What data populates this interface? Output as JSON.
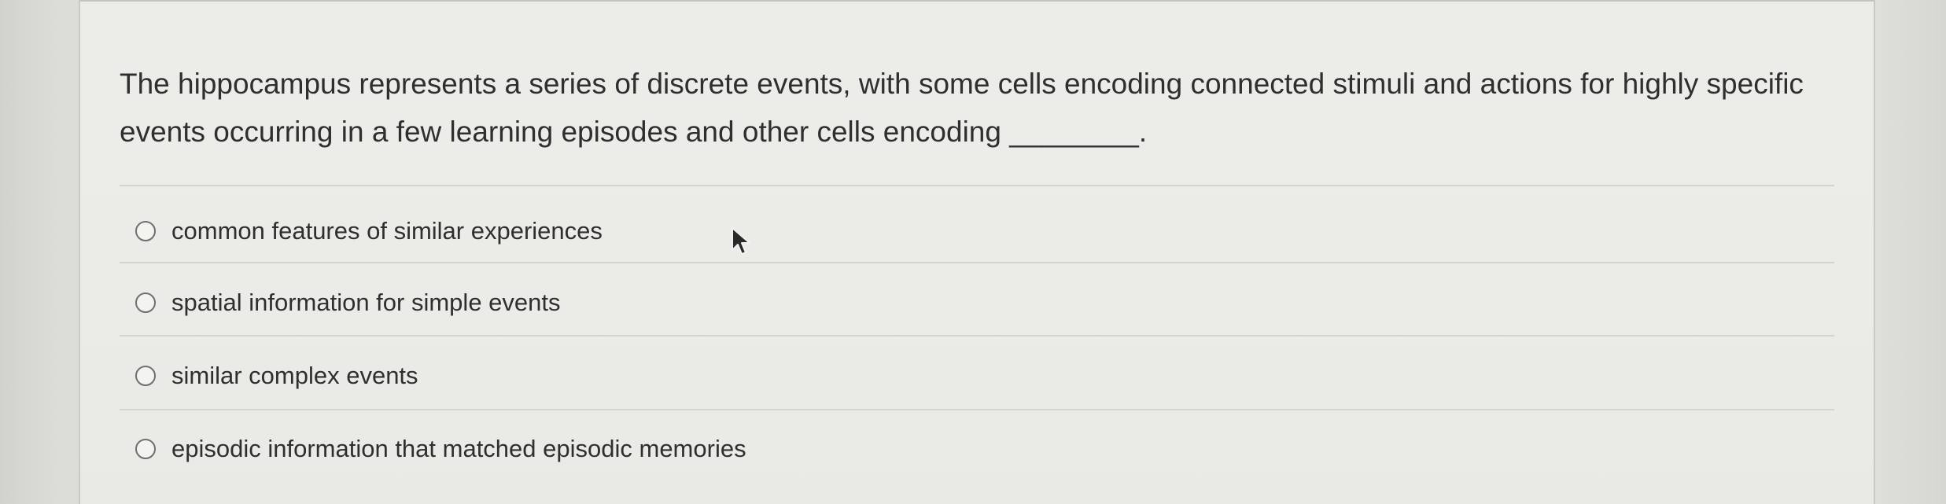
{
  "question": {
    "text": "The hippocampus represents a series of discrete events, with some cells encoding connected stimuli and actions for highly specific events occurring in a few learning episodes and other cells encoding ________."
  },
  "options": [
    {
      "label": "common features of similar experiences"
    },
    {
      "label": "spatial information for simple events"
    },
    {
      "label": "similar complex events"
    },
    {
      "label": "episodic information that matched episodic memories"
    }
  ],
  "icons": {
    "radio": "radio-circle-icon",
    "cursor": "mouse-pointer-icon"
  },
  "colors": {
    "text": "#2f2f2f",
    "background": "#e6e6e2",
    "radio_border": "#6f6f6f"
  }
}
